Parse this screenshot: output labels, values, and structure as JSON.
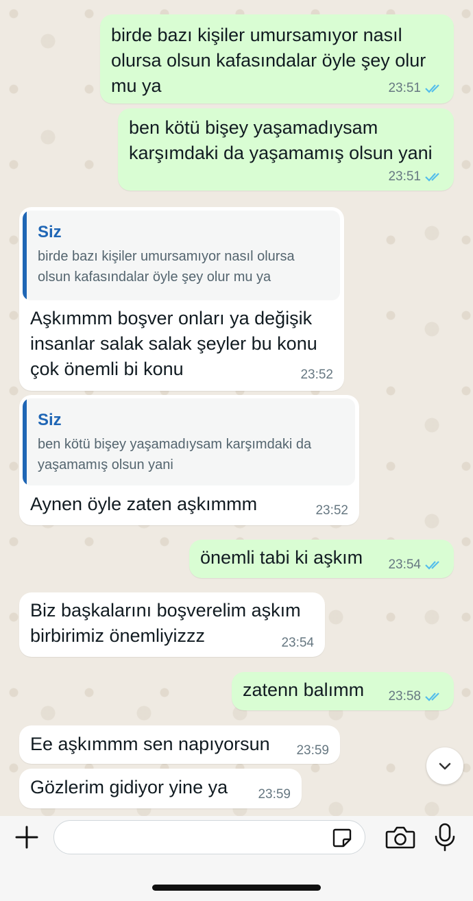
{
  "messages": [
    {
      "id": 1,
      "dir": "out",
      "text": "birde bazı kişiler umursamıyor nasıl\nolursa olsun kafasındalar öyle şey olur\nmu ya",
      "time": "23:51",
      "read": true
    },
    {
      "id": 2,
      "dir": "out",
      "text": "ben kötü bişey yaşamadıysam\nkarşımdaki da yaşamamış olsun yani",
      "time": "23:51",
      "read": true
    },
    {
      "id": 3,
      "dir": "in",
      "quote": {
        "name": "Siz",
        "text": "birde bazı kişiler umursamıyor nasıl olursa\nolsun kafasındalar öyle şey olur mu ya"
      },
      "text": "Aşkımmm boşver onları ya değişik\ninsanlar salak salak şeyler bu konu\nçok önemli bi konu",
      "time": "23:52"
    },
    {
      "id": 4,
      "dir": "in",
      "quote": {
        "name": "Siz",
        "text": "ben kötü bişey yaşamadıysam karşımdaki da\nyaşamamış olsun yani"
      },
      "text": "Aynen öyle zaten aşkımmm",
      "time": "23:52"
    },
    {
      "id": 5,
      "dir": "out",
      "text": "önemli tabi ki aşkım",
      "time": "23:54",
      "read": true
    },
    {
      "id": 6,
      "dir": "in",
      "text": "Biz başkalarını boşverelim aşkım\nbirbirimiz önemliyizzz",
      "time": "23:54"
    },
    {
      "id": 7,
      "dir": "out",
      "text": "zatenn balımm",
      "time": "23:58",
      "read": true
    },
    {
      "id": 8,
      "dir": "in",
      "text": "Ee aşkımmm sen napıyorsun",
      "time": "23:59"
    },
    {
      "id": 9,
      "dir": "in",
      "text": "Gözlerim gidiyor yine ya",
      "time": "23:59"
    }
  ],
  "composer": {
    "value": "",
    "placeholder": ""
  },
  "icons": {
    "attach": "plus-icon",
    "sticker": "sticker-icon",
    "camera": "camera-icon",
    "mic": "microphone-icon",
    "scroll": "chevron-down-icon",
    "read": "double-check-icon"
  },
  "colors": {
    "outgoing_bubble": "#d9fdd3",
    "incoming_bubble": "#ffffff",
    "quote_accent": "#1f66b5",
    "read_ticks": "#53bdeb",
    "background": "#efeae2"
  }
}
